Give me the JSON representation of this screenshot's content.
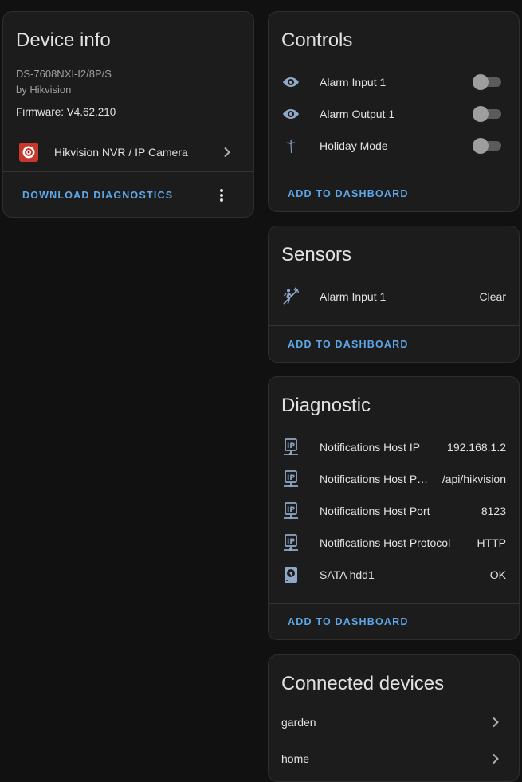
{
  "device_info": {
    "title": "Device info",
    "model": "DS-7608NXI-I2/8P/S",
    "manufacturer": "by Hikvision",
    "firmware": "Firmware: V4.62.210",
    "integration": "Hikvision NVR / IP Camera",
    "action": "DOWNLOAD DIAGNOSTICS"
  },
  "controls": {
    "title": "Controls",
    "items": [
      {
        "label": "Alarm Input 1",
        "icon": "eye-icon",
        "state": "off"
      },
      {
        "label": "Alarm Output 1",
        "icon": "eye-icon",
        "state": "off"
      },
      {
        "label": "Holiday Mode",
        "icon": "palm-tree-icon",
        "state": "off"
      }
    ],
    "action": "ADD TO DASHBOARD"
  },
  "sensors": {
    "title": "Sensors",
    "items": [
      {
        "label": "Alarm Input 1",
        "value": "Clear",
        "icon": "motion-sensor-icon"
      }
    ],
    "action": "ADD TO DASHBOARD"
  },
  "diagnostic": {
    "title": "Diagnostic",
    "items": [
      {
        "label": "Notifications Host IP",
        "value": "192.168.1.2",
        "icon": "ip-network-icon"
      },
      {
        "label": "Notifications Host P…",
        "value": "/api/hikvision",
        "icon": "ip-network-icon"
      },
      {
        "label": "Notifications Host Port",
        "value": "8123",
        "icon": "ip-network-icon"
      },
      {
        "label": "Notifications Host Protocol",
        "value": "HTTP",
        "icon": "ip-network-icon"
      },
      {
        "label": "SATA hdd1",
        "value": "OK",
        "icon": "harddisk-icon"
      }
    ],
    "action": "ADD TO DASHBOARD"
  },
  "connected": {
    "title": "Connected devices",
    "items": [
      {
        "label": "garden"
      },
      {
        "label": "home"
      }
    ]
  },
  "colors": {
    "background": "#111111",
    "card": "#1c1c1c",
    "accent": "#5da6e8",
    "icon": "#8fa8c8"
  }
}
